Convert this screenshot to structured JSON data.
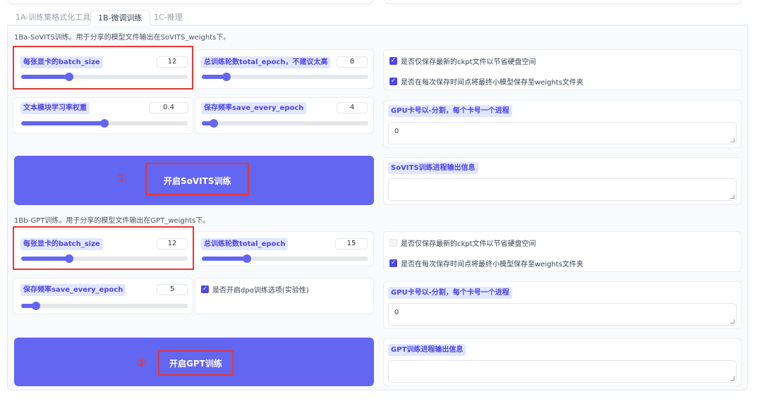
{
  "tabs": [
    {
      "label": "1A-训练集格式化工具"
    },
    {
      "label": "1B-微调训练"
    },
    {
      "label": "1C-推理"
    }
  ],
  "sovits": {
    "desc": "1Ba-SoVITS训练。用于分享的模型文件输出在SoVITS_weights下。",
    "batch_size": {
      "label": "每张显卡的batch_size",
      "value": "12",
      "fraction": 0.29
    },
    "total_epoch": {
      "label": "总训练轮数total_epoch，不建议太高",
      "value": "8",
      "fraction": 0.15
    },
    "text_lr": {
      "label": "文本模块学习率权重",
      "value": "0.4",
      "fraction": 0.5
    },
    "save_every": {
      "label": "保存频率save_every_epoch",
      "value": "4",
      "fraction": 0.07
    },
    "opt_latest": {
      "label": "是否仅保存最新的ckpt文件以节省硬盘空间",
      "checked": true
    },
    "opt_save_weights": {
      "label": "是否在每次保存时间点将最终小模型保存至weights文件夹",
      "checked": true
    },
    "gpu": {
      "label": "GPU卡号以-分割，每个卡号一个进程",
      "value": "0"
    },
    "button": {
      "label": "开启SoVITS训练",
      "marker": "①"
    },
    "output": {
      "label": "SoVITS训练进程输出信息",
      "value": ""
    }
  },
  "gpt": {
    "desc": "1Bb-GPT训练。用于分享的模型文件输出在GPT_weights下。",
    "batch_size": {
      "label": "每张显卡的batch_size",
      "value": "12",
      "fraction": 0.29
    },
    "total_epoch": {
      "label": "总训练轮数total_epoch",
      "value": "15",
      "fraction": 0.27
    },
    "save_every": {
      "label": "保存频率save_every_epoch",
      "value": "5",
      "fraction": 0.09
    },
    "dpo": {
      "label": "是否开启dpo训练选项(实验性)",
      "checked": true
    },
    "opt_latest": {
      "label": "是否仅保存最新的ckpt文件以节省硬盘空间",
      "checked": false
    },
    "opt_save_weights": {
      "label": "是否在每次保存时间点将最终小模型保存至weights文件夹",
      "checked": true
    },
    "gpu": {
      "label": "GPU卡号以-分割，每个卡号一个进程",
      "value": "0"
    },
    "button": {
      "label": "开启GPT训练",
      "marker": "②"
    },
    "output": {
      "label": "GPT训练进程输出信息",
      "value": ""
    }
  },
  "colors": {
    "accent": "#6366f1",
    "label_bg": "#e0e7ff",
    "annotation_red": "#e53935"
  }
}
